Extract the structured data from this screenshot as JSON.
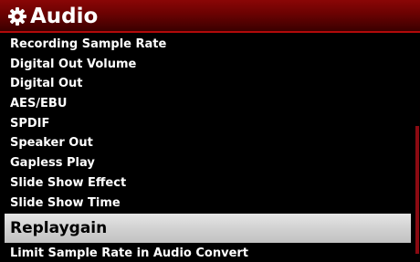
{
  "header": {
    "title": "Audio",
    "icon": "gear-icon",
    "background_color": "#6a0202"
  },
  "menu": {
    "items": [
      {
        "label": "Recording Sample Rate"
      },
      {
        "label": "Digital Out Volume"
      },
      {
        "label": "Digital Out"
      },
      {
        "label": "AES/EBU"
      },
      {
        "label": "SPDIF"
      },
      {
        "label": "Speaker Out"
      },
      {
        "label": "Gapless Play"
      },
      {
        "label": "Slide Show Effect"
      },
      {
        "label": "Slide Show Time"
      },
      {
        "label": "Replaygain",
        "selected": true
      },
      {
        "label": "Limit Sample Rate in Audio Convert"
      }
    ],
    "highlight_color": "#d2d2d2",
    "scrollbar_color": "#8a0a12"
  }
}
